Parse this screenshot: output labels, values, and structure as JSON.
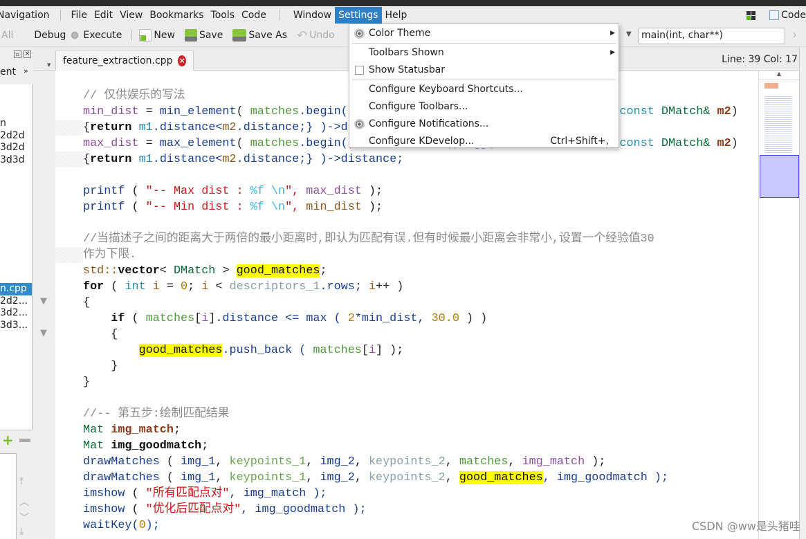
{
  "menubar": {
    "items": [
      "Navigation",
      "File",
      "Edit",
      "View",
      "Bookmarks",
      "Tools",
      "Code",
      "Window",
      "Settings",
      "Help"
    ],
    "active": "Settings",
    "right_label": "Code"
  },
  "toolbar": {
    "all": "All",
    "debug": "Debug",
    "execute": "Execute",
    "new": "New",
    "save": "Save",
    "save_as": "Save As",
    "undo": "Undo",
    "function_box": "main(int, char**)"
  },
  "tab": {
    "label": "feature_extraction.cpp"
  },
  "status": {
    "line_col": "Line: 39 Col: 17"
  },
  "left_panel": {
    "header": "ent",
    "items": [
      "n",
      "2d2d",
      "3d2d",
      "3d3d"
    ],
    "items2": [
      "n.cpp",
      "2d2...",
      "3d2...",
      "3d3..."
    ]
  },
  "settings_menu": [
    {
      "label": "Color Theme",
      "icon": "radio-icon",
      "submenu": true
    },
    {
      "label": "Toolbars Shown",
      "submenu": true
    },
    {
      "label": "Show Statusbar",
      "checkbox": false
    },
    {
      "label": "Configure Keyboard Shortcuts..."
    },
    {
      "label": "Configure Toolbars..."
    },
    {
      "label": "Configure Notifications...",
      "icon": "radio-icon"
    },
    {
      "label": "Configure KDevelop...",
      "shortcut": "Ctrl+Shift+,"
    }
  ],
  "code": {
    "lines": [
      [
        [
          "// 仅供娱乐的写法",
          "cmt"
        ]
      ],
      [
        [
          "min_dist",
          "var"
        ],
        [
          " = ",
          "p"
        ],
        [
          "min_element",
          "fn"
        ],
        [
          "( ",
          "p"
        ],
        [
          "matches",
          "mem"
        ],
        [
          ".begin(), matches.end(), [](const DMatch& m1, ",
          "fn"
        ],
        [
          "const ",
          "m"
        ],
        [
          "DMatch& ",
          "type"
        ],
        [
          "m2",
          "bold"
        ],
        [
          ")",
          "p"
        ]
      ],
      [
        [
          "{",
          "p"
        ],
        [
          "return",
          "kw"
        ],
        [
          " ",
          "p"
        ],
        [
          "m1",
          "m"
        ],
        [
          ".distance<",
          "fn"
        ],
        [
          "m2",
          "loc"
        ],
        [
          ".distance;} )->distance;",
          "fn"
        ]
      ],
      [
        [
          "max_dist",
          "var"
        ],
        [
          " = ",
          "p"
        ],
        [
          "max_element",
          "fn"
        ],
        [
          "( ",
          "p"
        ],
        [
          "matches",
          "mem"
        ],
        [
          ".begin(), matches.end(), [](const DMatch& m1, ",
          "fn"
        ],
        [
          "const ",
          "m"
        ],
        [
          "DMatch& ",
          "type"
        ],
        [
          "m2",
          "bold"
        ],
        [
          ")",
          "p"
        ]
      ],
      [
        [
          "{",
          "p"
        ],
        [
          "return",
          "kw"
        ],
        [
          " ",
          "p"
        ],
        [
          "m1",
          "m"
        ],
        [
          ".distance<",
          "fn"
        ],
        [
          "m2",
          "loc"
        ],
        [
          ".distance;} )->distance;",
          "fn"
        ]
      ],
      [],
      [
        [
          "printf",
          "fn"
        ],
        [
          " ( ",
          "p"
        ],
        [
          "\"-- Max dist : ",
          "str"
        ],
        [
          "%f \\n",
          "esc"
        ],
        [
          "\", ",
          "str"
        ],
        [
          "max_dist",
          "var"
        ],
        [
          " );",
          "p"
        ]
      ],
      [
        [
          "printf",
          "fn"
        ],
        [
          " ( ",
          "p"
        ],
        [
          "\"-- Min dist : ",
          "str"
        ],
        [
          "%f \\n",
          "esc"
        ],
        [
          "\", ",
          "str"
        ],
        [
          "min_dist",
          "loc"
        ],
        [
          " );",
          "p"
        ]
      ],
      [],
      [
        [
          "//当描述子之间的距离大于两倍的最小距离时,即认为匹配有误.但有时候最小距离会非常小,设置一个经验值30",
          "cmt"
        ]
      ],
      [
        [
          "作为下限.",
          "cmt"
        ]
      ],
      [
        [
          "std::",
          "loc"
        ],
        [
          "vector",
          "bk"
        ],
        [
          "< ",
          "p"
        ],
        [
          "DMatch",
          "type"
        ],
        [
          " > ",
          "p"
        ],
        [
          "good_matches",
          "hl"
        ],
        [
          ";",
          "p"
        ]
      ],
      [
        [
          "for",
          "kw"
        ],
        [
          " ( ",
          "p"
        ],
        [
          "int",
          "m"
        ],
        [
          " ",
          "p"
        ],
        [
          "i",
          "loc"
        ],
        [
          " = ",
          "p"
        ],
        [
          "0",
          "num"
        ],
        [
          "; ",
          "p"
        ],
        [
          "i",
          "loc"
        ],
        [
          " < ",
          "p"
        ],
        [
          "descriptors_1",
          "tgr"
        ],
        [
          ".rows; ",
          "fn"
        ],
        [
          "i",
          "loc"
        ],
        [
          "++ )",
          "p"
        ]
      ],
      [
        [
          "{",
          "p"
        ]
      ],
      [
        [
          "    ",
          "p"
        ],
        [
          "if",
          "kw"
        ],
        [
          " ( ",
          "p"
        ],
        [
          "matches",
          "mem"
        ],
        [
          "[",
          "p"
        ],
        [
          "i",
          "var"
        ],
        [
          "]",
          "p"
        ],
        [
          ".distance <= max ( ",
          "fn"
        ],
        [
          "2",
          "num"
        ],
        [
          "*min_dist, ",
          "fn"
        ],
        [
          "30.0",
          "num"
        ],
        [
          " ) )",
          "p"
        ]
      ],
      [
        [
          "    {",
          "p"
        ]
      ],
      [
        [
          "        ",
          "p"
        ],
        [
          "good_matches",
          "hl"
        ],
        [
          ".push_back ( ",
          "fn"
        ],
        [
          "matches",
          "mem"
        ],
        [
          "[",
          "p"
        ],
        [
          "i",
          "var"
        ],
        [
          "] );",
          "p"
        ]
      ],
      [
        [
          "    }",
          "p"
        ]
      ],
      [
        [
          "}",
          "p"
        ]
      ],
      [],
      [
        [
          "//-- 第五步:绘制匹配结果",
          "cmt"
        ]
      ],
      [
        [
          "Mat ",
          "type"
        ],
        [
          "img_match",
          "bold"
        ],
        [
          ";",
          "p"
        ]
      ],
      [
        [
          "Mat ",
          "type"
        ],
        [
          "img_goodmatch",
          "bk"
        ],
        [
          ";",
          "p"
        ]
      ],
      [
        [
          "drawMatches",
          "fn"
        ],
        [
          " ( ",
          "p"
        ],
        [
          "img_1",
          "fn"
        ],
        [
          ", ",
          "p"
        ],
        [
          "keypoints_1",
          "kb"
        ],
        [
          ", ",
          "p"
        ],
        [
          "img_2",
          "fn"
        ],
        [
          ", ",
          "p"
        ],
        [
          "keypoints_2",
          "tgr"
        ],
        [
          ", ",
          "p"
        ],
        [
          "matches",
          "mem"
        ],
        [
          ", ",
          "p"
        ],
        [
          "img_match",
          "var"
        ],
        [
          " );",
          "p"
        ]
      ],
      [
        [
          "drawMatches",
          "fn"
        ],
        [
          " ( ",
          "p"
        ],
        [
          "img_1",
          "fn"
        ],
        [
          ", ",
          "p"
        ],
        [
          "keypoints_1",
          "kb"
        ],
        [
          ", ",
          "p"
        ],
        [
          "img_2",
          "fn"
        ],
        [
          ", ",
          "p"
        ],
        [
          "keypoints_2",
          "tgr"
        ],
        [
          ", ",
          "p"
        ],
        [
          "good_matches",
          "hl"
        ],
        [
          ", img_goodmatch );",
          "fn"
        ]
      ],
      [
        [
          "imshow",
          "fn"
        ],
        [
          " ( ",
          "p"
        ],
        [
          "\"所有匹配点对\"",
          "str"
        ],
        [
          ", img_match );",
          "fn"
        ]
      ],
      [
        [
          "imshow",
          "fn"
        ],
        [
          " ( ",
          "p"
        ],
        [
          "\"优化后匹配点对\"",
          "str"
        ],
        [
          ", img_goodmatch );",
          "fn"
        ]
      ],
      [
        [
          "waitKey(",
          "fn"
        ],
        [
          "0",
          "num"
        ],
        [
          ");",
          "fn"
        ]
      ]
    ],
    "wrapped_lines": [
      2,
      4,
      10
    ]
  },
  "watermark": "CSDN @ww是头猪哇",
  "colors": {
    "accent": "#2f7fc5",
    "highlight": "#ffff00",
    "close": "#d3212d"
  }
}
